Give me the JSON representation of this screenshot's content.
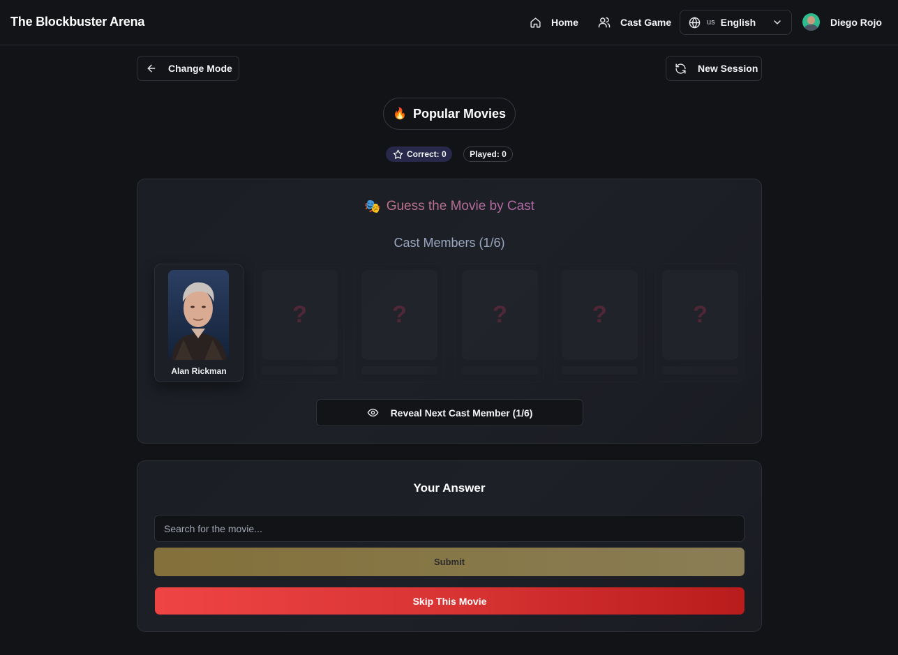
{
  "header": {
    "brand": "The Blockbuster Arena",
    "nav": [
      {
        "label": "Home",
        "icon": "home-icon"
      },
      {
        "label": "Cast Game",
        "icon": "users-icon"
      }
    ],
    "language": {
      "code": "us",
      "label": "English"
    },
    "user": {
      "name": "Diego Rojo"
    }
  },
  "toolbar": {
    "change_mode_label": "Change Mode",
    "new_session_label": "New Session"
  },
  "mode": {
    "emoji": "🔥",
    "label": "Popular Movies"
  },
  "stats": {
    "correct": "Correct: 0",
    "played": "Played: 0"
  },
  "cast_panel": {
    "title_emoji": "🎭",
    "title": "Guess the Movie by Cast",
    "subtitle": "Cast Members (1/6)",
    "members": [
      {
        "name": "Alan Rickman",
        "revealed": true
      },
      {
        "name": "",
        "revealed": false,
        "placeholder": "?"
      },
      {
        "name": "",
        "revealed": false,
        "placeholder": "?"
      },
      {
        "name": "",
        "revealed": false,
        "placeholder": "?"
      },
      {
        "name": "",
        "revealed": false,
        "placeholder": "?"
      },
      {
        "name": "",
        "revealed": false,
        "placeholder": "?"
      }
    ],
    "reveal_button": "Reveal Next Cast Member (1/6)"
  },
  "answer_panel": {
    "title": "Your Answer",
    "search_placeholder": "Search for the movie...",
    "submit_label": "Submit",
    "skip_label": "Skip This Movie"
  },
  "colors": {
    "background": "#111317",
    "card": "#1c1f25",
    "accent_gradient_start": "#c07389",
    "submit": "#877849",
    "skip": "#dc2626",
    "placeholder_mark": "#7d2f45"
  }
}
